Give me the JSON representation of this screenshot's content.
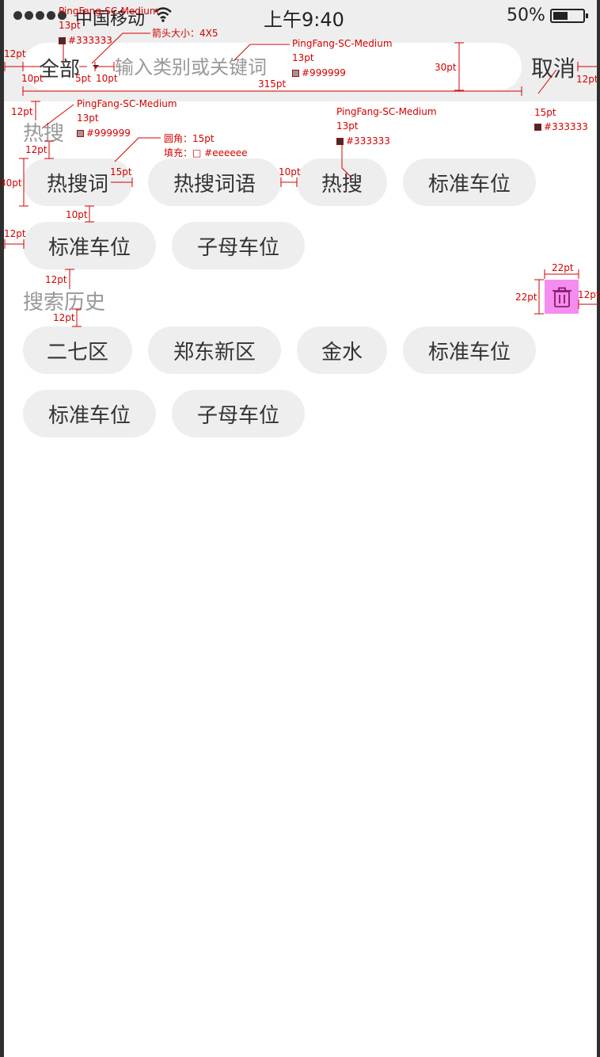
{
  "status_bar": {
    "carrier": "中国移动",
    "time": "上午9:40",
    "battery_percent": "50%",
    "battery_level": 0.5
  },
  "search_bar": {
    "scope_label": "全部",
    "placeholder": "输入类别或关键词",
    "value": "",
    "cancel_label": "取消"
  },
  "hot_search": {
    "title": "热搜",
    "items": [
      "热搜词",
      "热搜词语",
      "热搜",
      "标准车位",
      "标准车位",
      "子母车位"
    ]
  },
  "history": {
    "title": "搜索历史",
    "clear_icon": "trash-icon",
    "items": [
      "二七区",
      "郑东新区",
      "金水",
      "标准车位",
      "标准车位",
      "子母车位"
    ]
  },
  "colors": {
    "text_primary": "#333333",
    "text_secondary": "#999999",
    "chip_fill": "#eeeeee",
    "annotation": "#d40000",
    "icon_highlight": "#f58cf0"
  },
  "annotations": {
    "font_name": "PingFang-SC-Medium",
    "size_13": "13pt",
    "size_15": "15pt",
    "color_333": "#333333",
    "color_999": "#999999",
    "arrow_size": "箭头大小：4X5",
    "radius": "圆角：15pt",
    "fill": "填充：□ #eeeeee",
    "m12": "12pt",
    "m10": "10pt",
    "m5": "5pt",
    "m15": "15pt",
    "m30": "30pt",
    "m22": "22pt",
    "w315": "315pt",
    "h30": "30pt"
  }
}
